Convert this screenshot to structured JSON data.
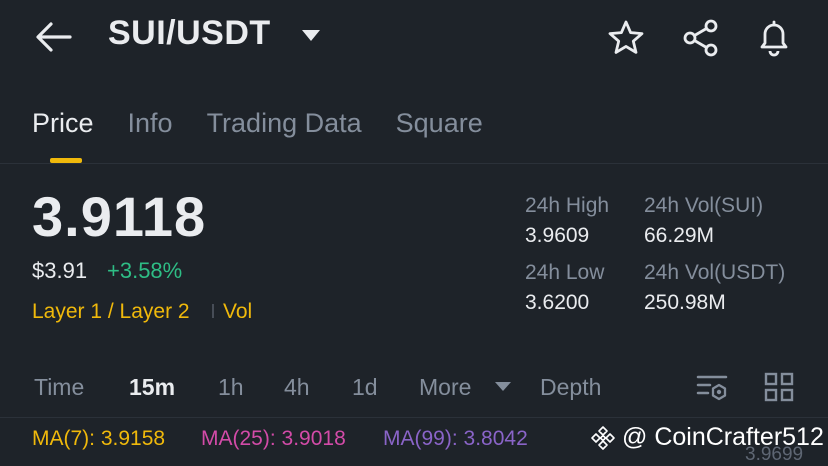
{
  "header": {
    "title": "SUI/USDT",
    "icons": [
      "back-icon",
      "chevron-down-icon",
      "star-icon",
      "share-icon",
      "bell-icon"
    ]
  },
  "tabs": [
    {
      "label": "Price",
      "active": true
    },
    {
      "label": "Info",
      "active": false
    },
    {
      "label": "Trading Data",
      "active": false
    },
    {
      "label": "Square",
      "active": false
    }
  ],
  "price": {
    "last": "3.9118",
    "usd": "$3.91",
    "change": "+3.58%",
    "tag_category": "Layer 1 / Layer 2",
    "tag_vol": "Vol"
  },
  "stats": {
    "high_label": "24h High",
    "high_value": "3.9609",
    "low_label": "24h Low",
    "low_value": "3.6200",
    "vol_sui_label": "24h Vol(SUI)",
    "vol_sui_value": "66.29M",
    "vol_usdt_label": "24h Vol(USDT)",
    "vol_usdt_value": "250.98M"
  },
  "intervals": {
    "time": "Time",
    "m15": "15m",
    "h1": "1h",
    "h4": "4h",
    "d1": "1d",
    "more": "More",
    "depth": "Depth",
    "selected": "15m"
  },
  "ma": {
    "ma7": "MA(7): 3.9158",
    "ma25": "MA(25): 3.9018",
    "ma99": "MA(99): 3.8042"
  },
  "watermark": "@ CoinCrafter512",
  "axis_price": "3.9699",
  "colors": {
    "background": "#1e2329",
    "accent": "#f0b90b",
    "up": "#2ebd85",
    "ma25": "#d34ba8",
    "ma99": "#8a64c8",
    "muted": "#848e9c"
  }
}
